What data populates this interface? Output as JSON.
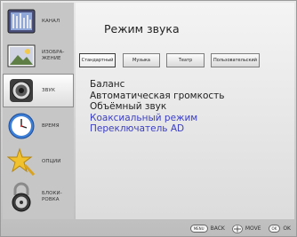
{
  "sidebar": {
    "items": [
      {
        "label": "КАНАЛ",
        "icon": "tv-tuning-icon",
        "active": false
      },
      {
        "label": "ИЗОБРА-\nЖЕНИЕ",
        "icon": "picture-icon",
        "active": false
      },
      {
        "label": "ЗВУК",
        "icon": "speaker-icon",
        "active": true
      },
      {
        "label": "ВРЕМЯ",
        "icon": "clock-icon",
        "active": false
      },
      {
        "label": "ОПЦИИ",
        "icon": "star-icon",
        "active": false
      },
      {
        "label": "БЛОКИ-\nРОВКА",
        "icon": "padlock-icon",
        "active": false
      }
    ]
  },
  "panel": {
    "title": "Режим звука",
    "tabs": [
      {
        "label": "Стандартный",
        "active": true
      },
      {
        "label": "Музыка",
        "active": false
      },
      {
        "label": "Театр",
        "active": false
      },
      {
        "label": "Пользовательский",
        "active": false
      }
    ],
    "options": [
      {
        "label": "Баланс",
        "highlight": false
      },
      {
        "label": "Автоматическая громкость",
        "highlight": false
      },
      {
        "label": "Объёмный звук",
        "highlight": false
      },
      {
        "label": "Коаксиальный режим",
        "highlight": true
      },
      {
        "label": "Переключатель AD",
        "highlight": true
      }
    ]
  },
  "footer": {
    "menu_key": "MENU",
    "back_label": "BACK",
    "move_label": "MOVE",
    "ok_key": "OK",
    "ok_label": "OK"
  },
  "colors": {
    "highlight_text": "#3b3ec2",
    "panel_bg": "#ececec",
    "sidebar_bg": "#c6c6c6"
  }
}
